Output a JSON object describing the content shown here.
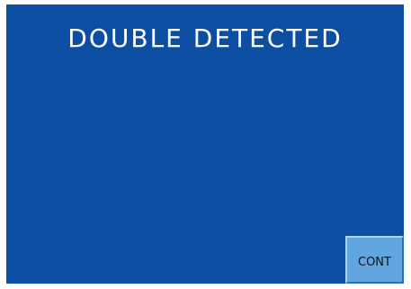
{
  "screen": {
    "title": "DOUBLE DETECTED",
    "background_color": "#0b4ea2",
    "text_color": "#ffffff"
  },
  "buttons": {
    "cont_label": "CONT",
    "cont_color": "#62a6e1"
  }
}
